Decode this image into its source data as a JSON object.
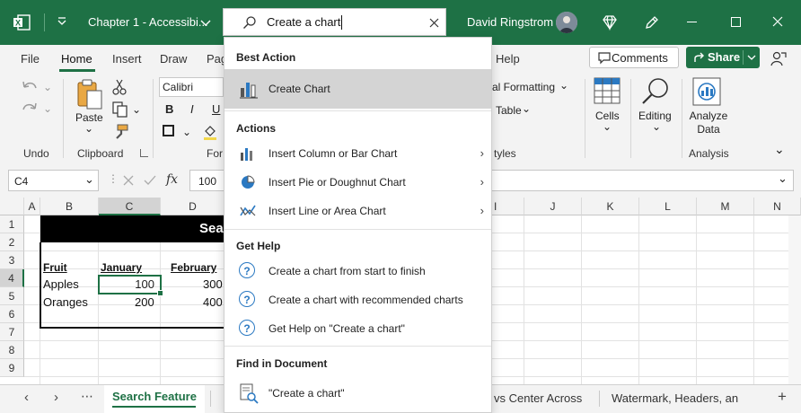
{
  "titlebar": {
    "document_title": "Chapter 1 - Accessibi...",
    "user_name": "David Ringstrom",
    "accent": "#1e7145"
  },
  "search": {
    "value": "Create a chart"
  },
  "ribbon_tabs": [
    "File",
    "Home",
    "Insert",
    "Draw",
    "Pag",
    "Help"
  ],
  "ribbon_buttons": {
    "comments": "Comments",
    "share": "Share"
  },
  "ribbon": {
    "paste": "Paste",
    "undo_group": "Undo",
    "clipboard_group": "Clipboard",
    "font_name": "Calibri",
    "font_group_partial": "For",
    "cond_format_partial": "al Formatting",
    "table_partial": "Table",
    "styles_partial": "tyles",
    "cells": "Cells",
    "editing": "Editing",
    "analyze_data": "Analyze Data",
    "analysis_group": "Analysis",
    "bold": "B",
    "italic": "I",
    "underline": "U"
  },
  "formula_bar": {
    "name_box": "C4",
    "fx": "fx",
    "value": "100"
  },
  "columns": [
    "A",
    "B",
    "C",
    "D",
    "I",
    "J",
    "K",
    "L",
    "M",
    "N"
  ],
  "rows": [
    "1",
    "2",
    "3",
    "4",
    "5",
    "6",
    "7",
    "8",
    "9"
  ],
  "sheet": {
    "banner_partial": "Sea",
    "headers": [
      "Fruit",
      "January",
      "February"
    ],
    "data": [
      {
        "fruit": "Apples",
        "january": "100",
        "february": "300"
      },
      {
        "fruit": "Oranges",
        "january": "200",
        "february": "400"
      }
    ]
  },
  "sheet_tabs": {
    "active": "Search Feature",
    "other_partial": "vs Center Across",
    "other2_partial": "Watermark, Headers, an"
  },
  "dropdown": {
    "best_action_heading": "Best Action",
    "best_action": "Create Chart",
    "actions_heading": "Actions",
    "actions": [
      "Insert Column or Bar Chart",
      "Insert Pie or Doughnut Chart",
      "Insert Line or Area Chart"
    ],
    "help_heading": "Get Help",
    "help": [
      "Create a chart from start to finish",
      "Create a chart with recommended charts",
      "Get Help on \"Create a chart\""
    ],
    "find_heading": "Find in Document",
    "find_item": "\"Create a chart\""
  }
}
